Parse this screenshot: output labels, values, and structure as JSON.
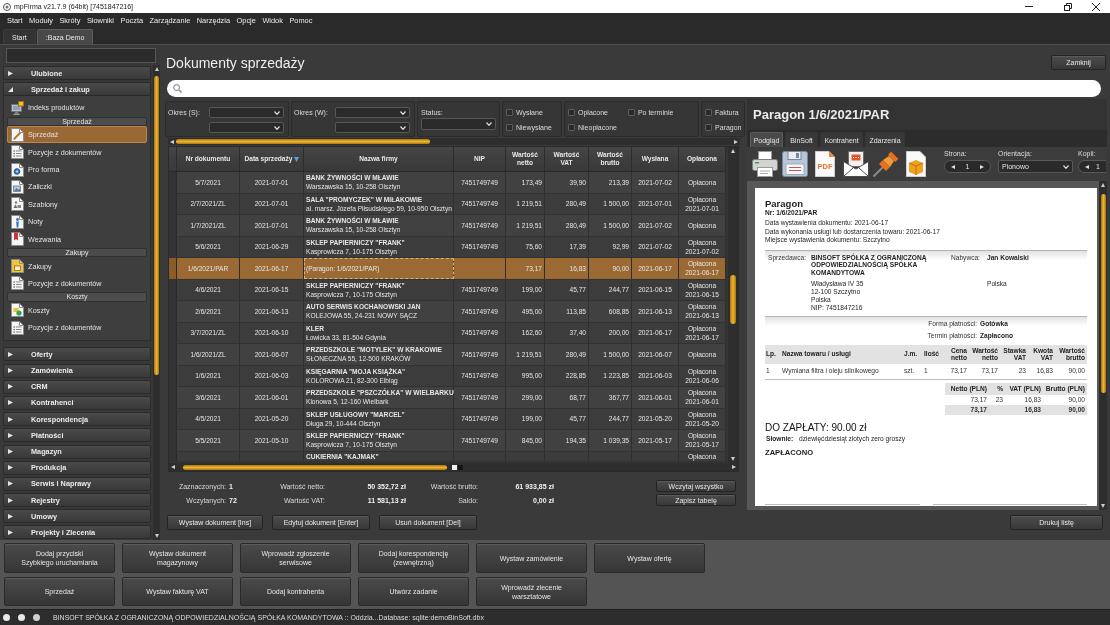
{
  "window": {
    "title": "mpFirma v21.7.9 (64bit) [7451847216]"
  },
  "menu": [
    "Start",
    "Moduły",
    "Skróty",
    "Słowniki",
    "Poczta",
    "Zarządzanie",
    "Narzędzia",
    "Opcje",
    "Widok",
    "Pomoc"
  ],
  "tabs": [
    {
      "label": "Start",
      "selected": false
    },
    {
      "label": ":Baza Demo",
      "selected": true
    }
  ],
  "sidebar": {
    "groups": [
      {
        "label": "Ulubione",
        "expanded": false
      },
      {
        "label": "Sprzedaż i zakup",
        "expanded": true,
        "items": [
          {
            "kind": "products",
            "label": "Indeks produktów",
            "selected": false
          },
          {
            "kind": "header",
            "label": "Sprzedaż"
          },
          {
            "kind": "sale",
            "label": "Sprzedaż",
            "selected": true
          },
          {
            "kind": "positions",
            "label": "Pozycje z dokumentów",
            "selected": false
          },
          {
            "kind": "proforma",
            "label": "Pro forma",
            "selected": false
          },
          {
            "kind": "advance",
            "label": "Zaliczki",
            "selected": false
          },
          {
            "kind": "template",
            "label": "Szablony",
            "selected": false
          },
          {
            "kind": "note",
            "label": "Noty",
            "selected": false
          },
          {
            "kind": "reminder",
            "label": "Wezwania",
            "selected": false
          },
          {
            "kind": "header",
            "label": "Zakupy"
          },
          {
            "kind": "purchase",
            "label": "Zakupy",
            "selected": false
          },
          {
            "kind": "positions",
            "label": "Pozycje z dokumentów",
            "selected": false
          },
          {
            "kind": "header",
            "label": "Koszty"
          },
          {
            "kind": "cost",
            "label": "Koszty",
            "selected": false
          },
          {
            "kind": "positions",
            "label": "Pozycje z dokumentów",
            "selected": false
          }
        ]
      },
      {
        "label": "Oferty",
        "expanded": false
      },
      {
        "label": "Zamówienia",
        "expanded": false
      },
      {
        "label": "CRM",
        "expanded": false
      },
      {
        "label": "Kontrahenci",
        "expanded": false
      },
      {
        "label": "Korespondencja",
        "expanded": false
      },
      {
        "label": "Płatności",
        "expanded": false
      },
      {
        "label": "Magazyn",
        "expanded": false
      },
      {
        "label": "Produkcja",
        "expanded": false
      },
      {
        "label": "Serwis i Naprawy",
        "expanded": false
      },
      {
        "label": "Rejestry",
        "expanded": false
      },
      {
        "label": "Umowy",
        "expanded": false
      },
      {
        "label": "Projekty i Zlecenia",
        "expanded": false
      }
    ]
  },
  "page": {
    "title": "Dokumenty sprzedaży",
    "close": "Zamknij"
  },
  "filters": {
    "selects": [
      {
        "label": "Okres (S):",
        "kind": "range"
      },
      {
        "label": "Okres (W):",
        "kind": "range"
      },
      {
        "label": "Status:",
        "kind": "single"
      }
    ],
    "checkbox_groups": [
      {
        "items": [
          {
            "label": "Wysłane",
            "checked": false
          },
          {
            "label": "Niewysłane",
            "checked": false
          }
        ]
      },
      {
        "items": [
          {
            "label": "Opłacone",
            "checked": false
          },
          {
            "label": "Nieopłacone",
            "checked": false
          },
          {
            "label": "Po terminie",
            "checked": false
          }
        ]
      },
      {
        "items": [
          {
            "label": "Faktura",
            "checked": false
          },
          {
            "label": "Paragon",
            "checked": false
          }
        ]
      }
    ]
  },
  "table": {
    "columns": [
      {
        "label": "Nr dokumentu",
        "sorted": false
      },
      {
        "label": "Data sprzedaży",
        "sorted": true
      },
      {
        "label": "Nazwa firmy",
        "sorted": false
      },
      {
        "label": "NIP",
        "sorted": false
      },
      {
        "label": "Wartość netto",
        "sorted": false
      },
      {
        "label": "Wartość VAT",
        "sorted": false
      },
      {
        "label": "Wartość brutto",
        "sorted": false
      },
      {
        "label": "Wysłana",
        "sorted": false
      },
      {
        "label": "Opłacona",
        "sorted": false
      }
    ],
    "rows": [
      {
        "nr": "5/7/2021",
        "date": "2021-07-01",
        "company": "BANK ŻYWNOŚCI W MŁAWIE",
        "address": "Warszawska 15, 10-258 Olsztyn",
        "nip": "7451749749",
        "netto": "173,49",
        "vat": "39,90",
        "brutto": "213,39",
        "sent": "2021-07-02",
        "paid": "Opłacona",
        "selected": false
      },
      {
        "nr": "2/7/2021/ZL",
        "date": "2021-07-01",
        "company": "SALA \"PROMYCZEK\" W MIŁAKOWIE",
        "address": "al. marsz. Józefa Piłsudskiego 59, 10-950 Olsztyn",
        "nip": "7451749749",
        "netto": "1 219,51",
        "vat": "280,49",
        "brutto": "1 500,00",
        "sent": "2021-07-01",
        "paid": "Opłacona",
        "paid_date": "2021-07-01",
        "selected": false
      },
      {
        "nr": "1/7/2021/ZL",
        "date": "2021-07-01",
        "company": "BANK ŻYWNOŚCI W MŁAWIE",
        "address": "Warszawska 15, 10-258 Olsztyn",
        "nip": "7451749749",
        "netto": "1 219,51",
        "vat": "280,49",
        "brutto": "1 500,00",
        "sent": "2021-07-02",
        "paid": "Opłacona",
        "selected": false
      },
      {
        "nr": "5/6/2021",
        "date": "2021-06-29",
        "company": "SKLEP PAPIERNICZY \"FRANK\"",
        "address": "Kasprowicza 7, 10-175 Olsztyn",
        "nip": "7451749749",
        "netto": "75,60",
        "vat": "17,39",
        "brutto": "92,99",
        "sent": "2021-07-02",
        "paid": "Opłacona",
        "paid_date": "2021-07-02",
        "selected": false
      },
      {
        "nr": "1/6/2021/PAR",
        "date": "2021-06-17",
        "description": "(Paragon: 1/6/2021/PAR)",
        "netto": "73,17",
        "vat": "16,83",
        "brutto": "90,00",
        "sent": "2021-06-17",
        "paid": "Opłacona",
        "paid_date": "2021-06-17",
        "selected": true
      },
      {
        "nr": "4/6/2021",
        "date": "2021-06-15",
        "company": "SKLEP PAPIERNICZY \"FRANK\"",
        "address": "Kasprowicza 7, 10-175 Olsztyn",
        "nip": "7451749749",
        "netto": "199,00",
        "vat": "45,77",
        "brutto": "244,77",
        "sent": "2021-06-15",
        "paid": "Opłacona",
        "paid_date": "2021-06-15",
        "selected": false
      },
      {
        "nr": "2/6/2021",
        "date": "2021-06-13",
        "company": "AUTO SERWIS KOCHANOWSKI JAN",
        "address": "KOLEJOWA 55, 24-231 NOWY SĄCZ",
        "nip": "7451749749",
        "netto": "495,00",
        "vat": "113,85",
        "brutto": "608,85",
        "sent": "2021-06-13",
        "paid": "Opłacona",
        "paid_date": "2021-06-13",
        "selected": false
      },
      {
        "nr": "3/7/2021/ZL",
        "date": "2021-06-10",
        "company": "KLER",
        "address": "Łowicka 33, 81-504 Gdynia",
        "nip": "7451749749",
        "netto": "162,60",
        "vat": "37,40",
        "brutto": "200,00",
        "sent": "2021-06-17",
        "paid": "Opłacona",
        "paid_date": "2021-06-17",
        "selected": false
      },
      {
        "nr": "1/6/2021/ZL",
        "date": "2021-06-07",
        "company": "PRZEDSZKOLE \"MOTYLEK\" W KRAKOWIE",
        "address": "SŁONECZNA 55, 12-500 KRAKÓW",
        "nip": "7451749749",
        "netto": "1 219,51",
        "vat": "280,49",
        "brutto": "1 500,00",
        "sent": "2021-06-07",
        "paid": "Opłacona",
        "selected": false
      },
      {
        "nr": "1/6/2021",
        "date": "2021-06-03",
        "company": "KSIĘGARNIA \"MOJA KSIĄŻKA\"",
        "address": "KOLOROWA 21, 82-300 Elbląg",
        "nip": "7451749749",
        "netto": "995,00",
        "vat": "228,85",
        "brutto": "1 223,85",
        "sent": "2021-06-03",
        "paid": "Opłacona",
        "paid_date": "2021-06-06",
        "selected": false
      },
      {
        "nr": "3/6/2021",
        "date": "2021-06-01",
        "company": "PRZEDSZKOLE \"PSZCZÓŁKA\" W WIELBARKU",
        "address": "Klonowa 5, 12-160 Wielbark",
        "nip": "7451749749",
        "netto": "299,00",
        "vat": "68,77",
        "brutto": "367,77",
        "sent": "2021-06-01",
        "paid": "Opłacona",
        "paid_date": "2021-06-01",
        "selected": false
      },
      {
        "nr": "4/5/2021",
        "date": "2021-05-20",
        "company": "SKLEP USŁUGOWY \"MARCEL\"",
        "address": "Długa 29, 10-444 Olsztyn",
        "nip": "7451749749",
        "netto": "199,00",
        "vat": "45,77",
        "brutto": "244,77",
        "sent": "2021-05-20",
        "paid": "Opłacona",
        "paid_date": "2021-05-20",
        "selected": false
      },
      {
        "nr": "5/5/2021",
        "date": "2021-05-10",
        "company": "SKLEP PAPIERNICZY \"FRANK\"",
        "address": "Kasprowicza 7, 10-175 Olsztyn",
        "nip": "7451749749",
        "netto": "845,00",
        "vat": "194,35",
        "brutto": "1 039,35",
        "sent": "2021-05-17",
        "paid": "Opłacona",
        "paid_date": "2021-05-17",
        "selected": false
      },
      {
        "company": "CUKIERNIA \"KAJMAK\"",
        "paid": "Opłacona",
        "selected": false
      }
    ]
  },
  "summary": [
    {
      "label": "Zaznaczonych:",
      "value": "1"
    },
    {
      "label": "Wczytanych:",
      "value": "72"
    },
    {
      "label": "Wartość netto:",
      "value": "50 352,72 zł"
    },
    {
      "label": "Wartość VAT:",
      "value": "11 581,13 zł"
    },
    {
      "label": "Wartość brutto:",
      "value": "61 933,85 zł"
    },
    {
      "label": "Saldo:",
      "value": "0,00 zł"
    }
  ],
  "list_buttons": [
    "Wczytaj wszystko",
    "Zapisz tabelę"
  ],
  "actions": [
    "Wystaw dokument [Ins]",
    "Edytuj dokument [Enter]",
    "Usuń dokument [Del]"
  ],
  "preview": {
    "title": "Paragon 1/6/2021/PAR",
    "tabs": [
      {
        "label": "Podgląd",
        "selected": true
      },
      {
        "label": "BinSoft",
        "selected": false
      },
      {
        "label": "Kontrahent",
        "selected": false
      },
      {
        "label": "Zdarzenia",
        "selected": false
      }
    ],
    "tools": [
      {
        "kind": "print"
      },
      {
        "kind": "save"
      },
      {
        "kind": "pdf",
        "label": "PDF"
      },
      {
        "kind": "email"
      },
      {
        "kind": "pin"
      },
      {
        "kind": "export"
      }
    ],
    "page": {
      "label": "Strona:",
      "value": "1"
    },
    "orientation": {
      "label": "Orientacja:",
      "value": "Pionowo"
    },
    "copies": {
      "label": "Kopii:",
      "value": "1"
    },
    "document": {
      "type": "Paragon",
      "number": "Nr: 1/6/2021/PAR",
      "dates": [
        "Data wystawienia dokumentu: 2021-06-17",
        "Data wykonania usługi lub dostarczenia towaru: 2021-06-17",
        "Miejsce wystawienia dokumentu: Szczytno"
      ],
      "seller_label": "Sprzedawca:",
      "seller_name": "BINSOFT SPÓŁKA Z OGRANICZONĄ ODPOWIEDZIALNOŚCIĄ SPÓŁKA KOMANDYTOWA",
      "seller_address": [
        "Władysława IV 35",
        "12-100 Szczytno",
        "Polska",
        "NIP: 7451847216"
      ],
      "buyer_label": "Nabywca:",
      "buyer_name": "Jan Kowalski",
      "buyer_address": [
        "Polska"
      ],
      "payment": [
        {
          "label": "Forma płatności:",
          "value": "Gotówka"
        },
        {
          "label": "Termin płatności:",
          "value": "Zapłacono"
        }
      ],
      "items_columns": [
        "Lp.",
        "Nazwa towaru / usługi",
        "J.m.",
        "Ilość",
        "Cena netto",
        "Wartość netto",
        "Stawka VAT",
        "Kwota VAT",
        "Wartość brutto"
      ],
      "items": [
        [
          "1",
          "Wymiana filtra i oleju silnikowego",
          "szt.",
          "1",
          "73,17",
          "73,17",
          "23",
          "16,83",
          "90,00"
        ]
      ],
      "totals_columns": [
        "Netto (PLN)",
        "%",
        "VAT (PLN)",
        "Brutto (PLN)"
      ],
      "totals_rows": [
        [
          "73,17",
          "23",
          "16,83",
          "90,00"
        ]
      ],
      "totals_sum": {
        "netto": "73,17",
        "vat": "16,83",
        "brutto": "90,00"
      },
      "due": "DO ZAPŁATY: 90.00 zł",
      "in_words_label": "Słownie:",
      "in_words": "dziewięćdziesiąt złotych zero groszy",
      "paid_stamp": "ZAPŁACONO"
    },
    "print_button": "Drukuj listę"
  },
  "quick_buttons": [
    "Dodaj przyciski\nSzybkiego uruchamiania",
    "Wystaw dokument\nmagazynowy",
    "Wprowadź zgłoszenie\nserwisowe",
    "Dodaj korespondencję\n(zewnętrzną)",
    "Wystaw zamówienie",
    "Wystaw ofertę",
    "Sprzedaż",
    "Wystaw fakturę VAT",
    "Dodaj kontrahenta",
    "Utwórz zadanie",
    "Wprowadź zlecenie\nwarsztatowe"
  ],
  "status_bar": {
    "text": "BINSOFT SPÓŁKA Z OGRANICZONĄ ODPOWIEDZIALNOŚCIĄ SPÓŁKA KOMANDYTOWA :: Oddzia...Database: sqlite:demoBinSoft.dbx"
  }
}
